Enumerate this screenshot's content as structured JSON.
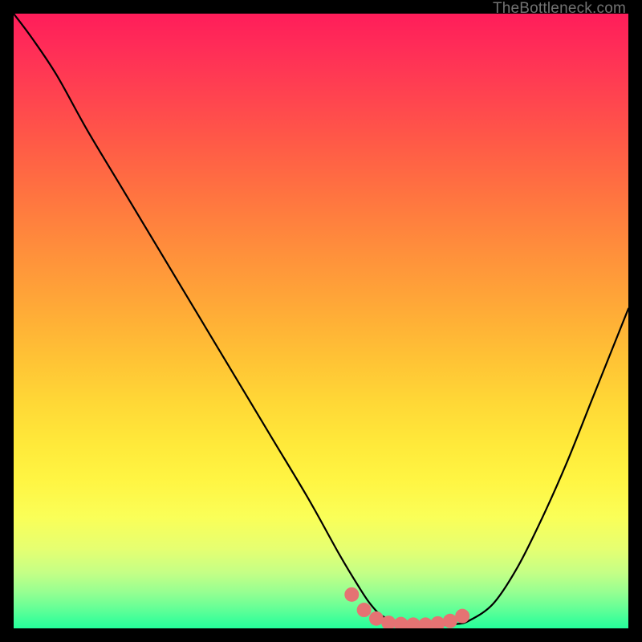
{
  "watermark_text": "TheBottleneck.com",
  "colors": {
    "background": "#000000",
    "curve_stroke": "#000000",
    "marker_fill": "#e57373",
    "marker_stroke": "#cc5a5a"
  },
  "chart_data": {
    "type": "line",
    "title": "",
    "xlabel": "",
    "ylabel": "",
    "xlim": [
      0,
      100
    ],
    "ylim": [
      0,
      100
    ],
    "series": [
      {
        "name": "bottleneck-curve",
        "x": [
          0,
          3,
          7,
          12,
          18,
          24,
          30,
          36,
          42,
          48,
          53,
          56,
          58,
          60,
          63,
          66,
          69,
          72,
          74,
          78,
          82,
          86,
          90,
          94,
          98,
          100
        ],
        "y": [
          100,
          96,
          90,
          81,
          71,
          61,
          51,
          41,
          31,
          21,
          12,
          7,
          4,
          2,
          0.8,
          0.5,
          0.5,
          0.7,
          1.2,
          4,
          10,
          18,
          27,
          37,
          47,
          52
        ]
      }
    ],
    "marker_points": {
      "name": "highlight-dots",
      "x": [
        55,
        57,
        59,
        61,
        63,
        65,
        67,
        69,
        71,
        73
      ],
      "y": [
        5.5,
        3.0,
        1.6,
        0.9,
        0.7,
        0.6,
        0.6,
        0.8,
        1.2,
        2.0
      ]
    }
  }
}
